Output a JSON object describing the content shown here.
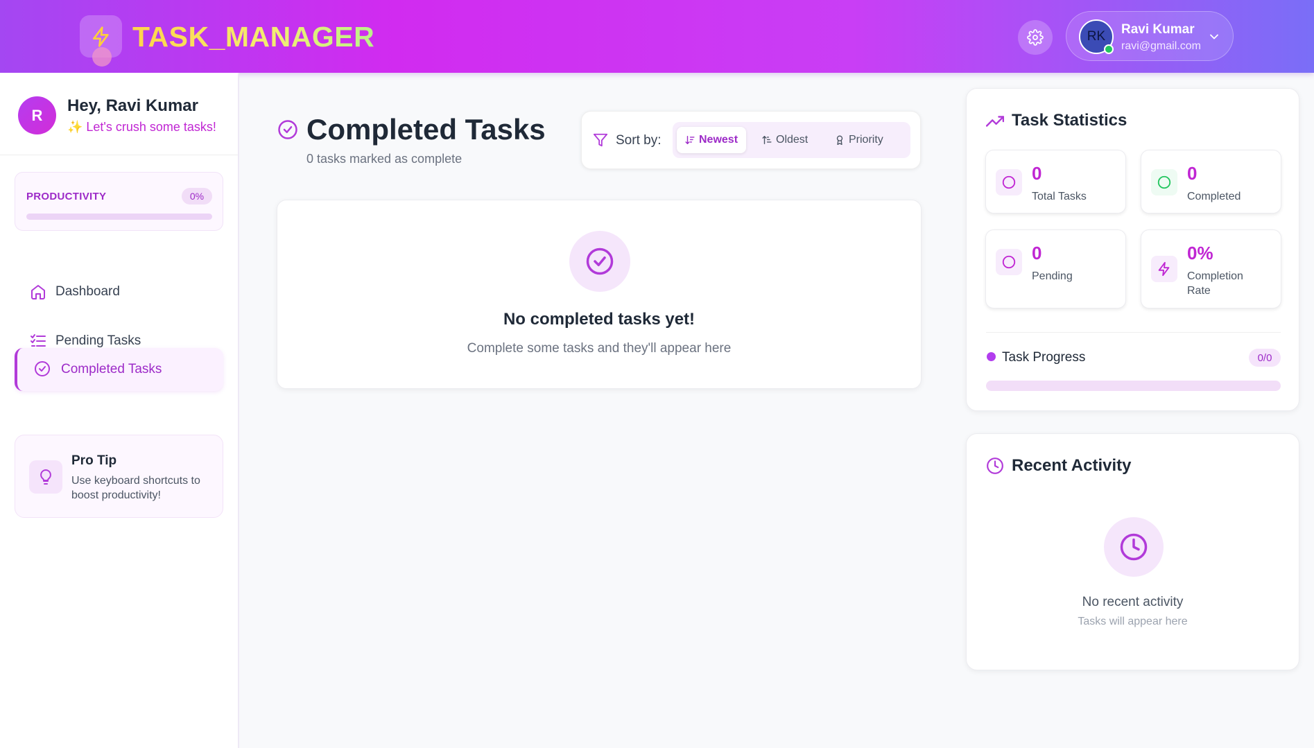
{
  "header": {
    "brand": "TASK_MANAGER",
    "user": {
      "initials": "RK",
      "name": "Ravi Kumar",
      "email": "ravi@gmail.com"
    }
  },
  "sidebar": {
    "avatar_letter": "R",
    "greeting": "Hey, Ravi Kumar",
    "subgreeting": "✨ Let's crush some tasks!",
    "productivity": {
      "label": "PRODUCTIVITY",
      "value": "0%",
      "fraction": 0
    },
    "nav": [
      {
        "label": "Dashboard",
        "icon": "home-icon",
        "active": false
      },
      {
        "label": "Pending Tasks",
        "icon": "list-check-icon",
        "active": false
      },
      {
        "label": "Completed Tasks",
        "icon": "check-circle-icon",
        "active": true
      }
    ],
    "tip": {
      "title": "Pro Tip",
      "text": "Use keyboard shortcuts to boost productivity!"
    }
  },
  "main": {
    "title": "Completed Tasks",
    "subtitle": "0 tasks marked as complete",
    "sort": {
      "label": "Sort by:",
      "options": [
        "Newest",
        "Oldest",
        "Priority"
      ],
      "selected": "Newest"
    },
    "empty": {
      "title": "No completed tasks yet!",
      "subtitle": "Complete some tasks and they'll appear here"
    }
  },
  "stats": {
    "title": "Task Statistics",
    "tiles": [
      {
        "value": "0",
        "label": "Total Tasks"
      },
      {
        "value": "0",
        "label": "Completed"
      },
      {
        "value": "0",
        "label": "Pending"
      },
      {
        "value": "0%",
        "label": "Completion Rate"
      }
    ],
    "progress": {
      "label": "Task Progress",
      "value": "0/0",
      "fraction": 0
    }
  },
  "activity": {
    "title": "Recent Activity",
    "empty_title": "No recent activity",
    "empty_sub": "Tasks will appear here"
  },
  "colors": {
    "accent": "#c026d3",
    "accent_dark": "#9d2bc8",
    "success": "#22c55e",
    "brand_yellow": "#ffd54a"
  }
}
